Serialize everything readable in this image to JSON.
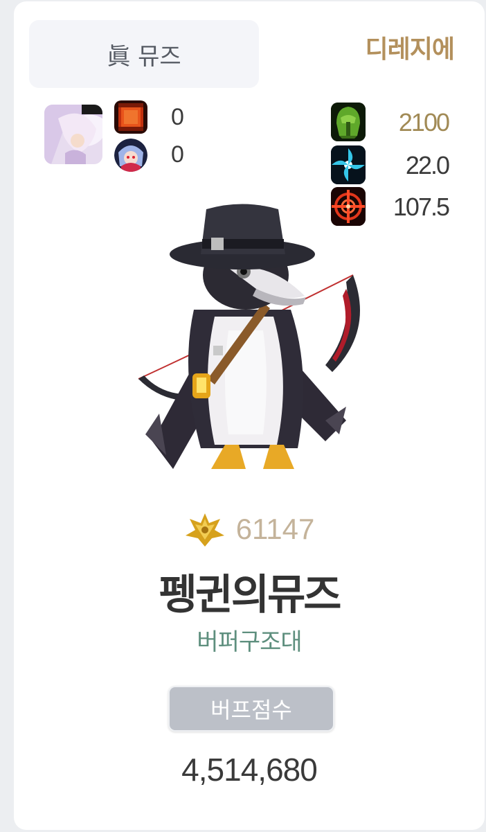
{
  "header": {
    "class_name": "眞 뮤즈",
    "server": "디레지에"
  },
  "equipment": {
    "portrait_icon": "character-portrait",
    "items": [
      {
        "icon": "red-book-icon",
        "count": "0"
      },
      {
        "icon": "character-face-icon",
        "count": "0"
      }
    ]
  },
  "stats": [
    {
      "icon": "green-helmet-icon",
      "value": "2100",
      "color": "#a18a55"
    },
    {
      "icon": "cyan-swirl-icon",
      "value": "22.0",
      "color": "#3a3a3a"
    },
    {
      "icon": "red-crosshair-icon",
      "value": "107.5",
      "color": "#3a3a3a"
    }
  ],
  "character": {
    "sprite": "plague-doctor-penguin",
    "level": "61147",
    "name": "펭귄의뮤즈",
    "guild": "버퍼구조대"
  },
  "score": {
    "label": "버프점수",
    "value": "4,514,680"
  }
}
